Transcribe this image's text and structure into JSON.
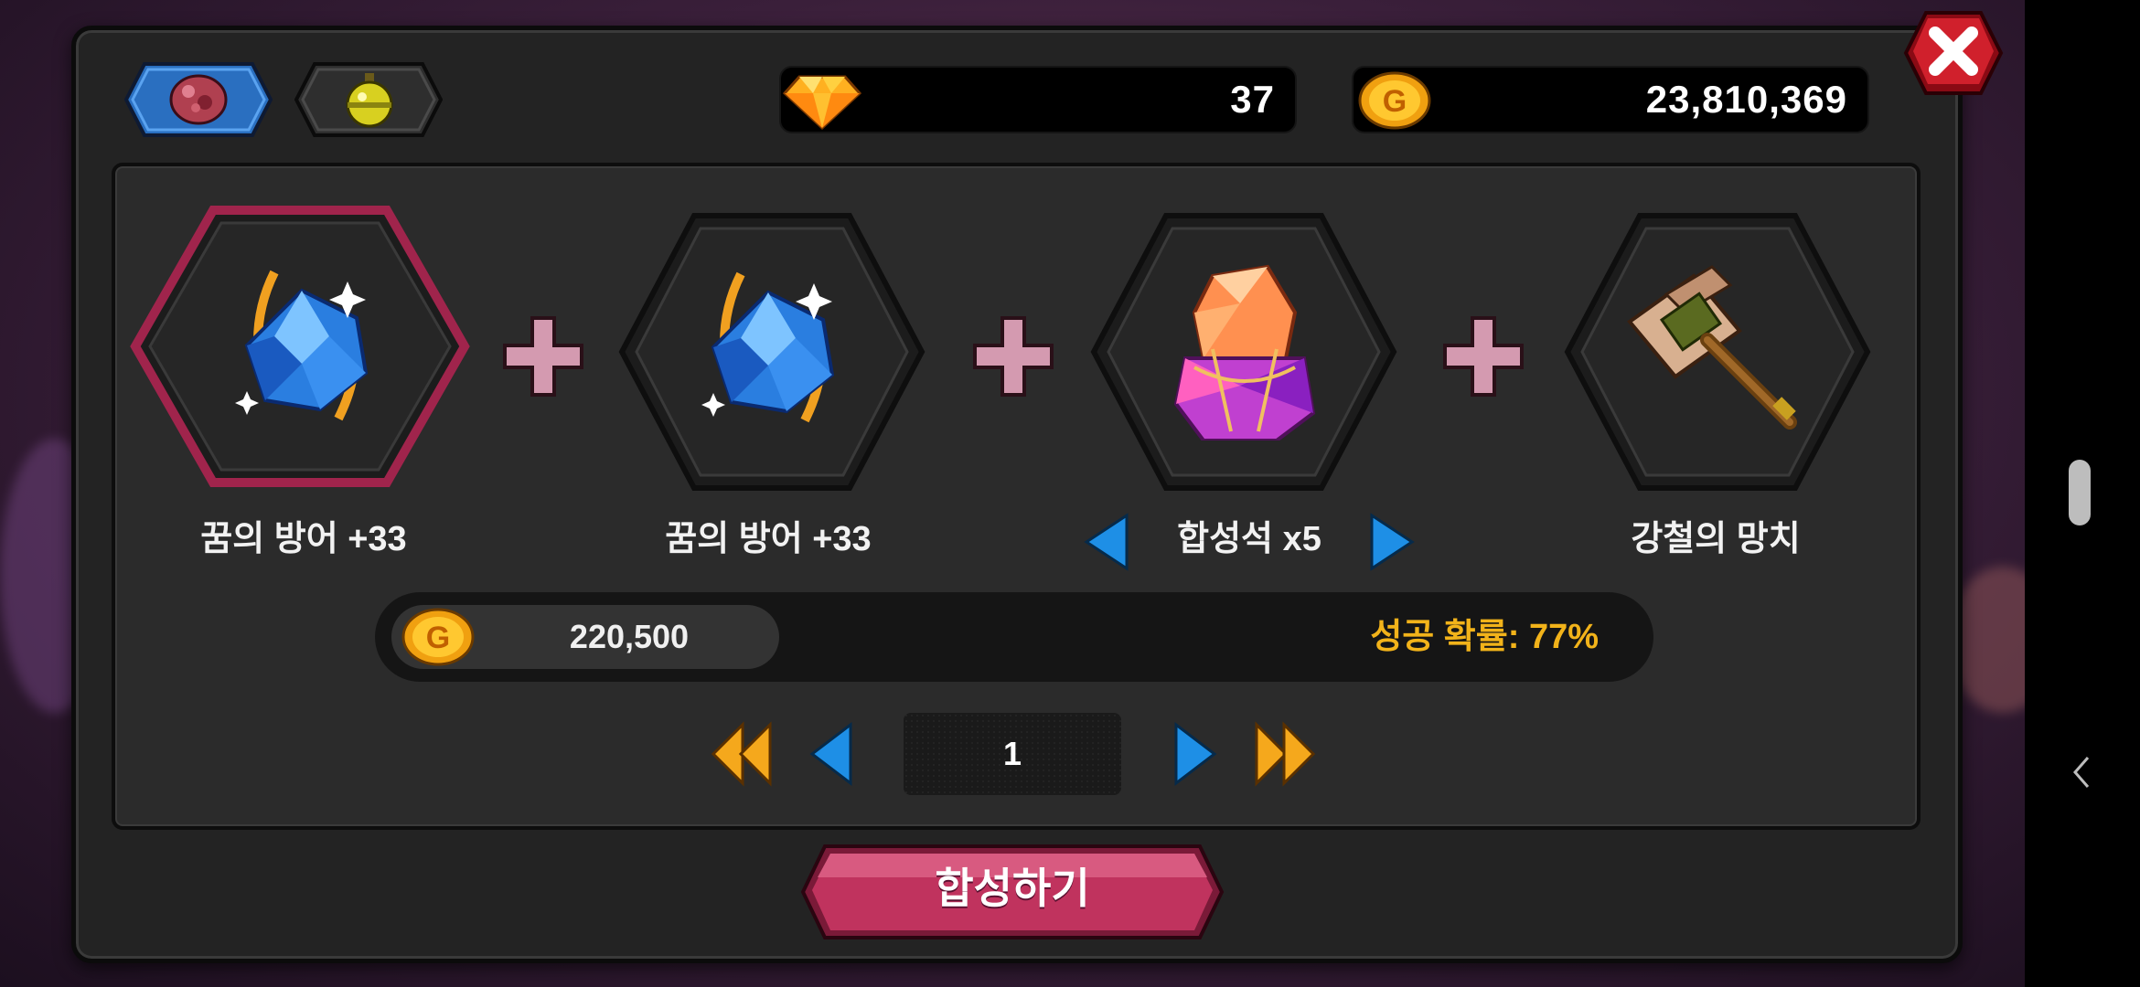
{
  "currency": {
    "gems": "37",
    "gold": "23,810,369"
  },
  "tabs": [
    {
      "name": "gem-tab",
      "icon": "red-gem-icon",
      "active": true
    },
    {
      "name": "potion-tab",
      "icon": "yellow-potion-icon",
      "active": false
    }
  ],
  "slots": [
    {
      "label": "꿈의 방어 +33",
      "icon": "blue-dream-gem-icon",
      "selected": true
    },
    {
      "label": "꿈의 방어 +33",
      "icon": "blue-dream-gem-icon",
      "selected": false
    },
    {
      "label": "합성석 x5",
      "icon": "synthesis-stone-icon",
      "selected": false
    },
    {
      "label": "강철의 망치",
      "icon": "steel-hammer-icon",
      "selected": false
    }
  ],
  "cost": {
    "gold": "220,500",
    "success_rate": "성공 확률: 77%"
  },
  "pagination": {
    "page": "1"
  },
  "compose_button": "합성하기",
  "colors": {
    "accent_red": "#c0335e",
    "success_text": "#f2b31a",
    "arrow_blue": "#1e8fe6",
    "arrow_gold": "#f5a81c"
  }
}
